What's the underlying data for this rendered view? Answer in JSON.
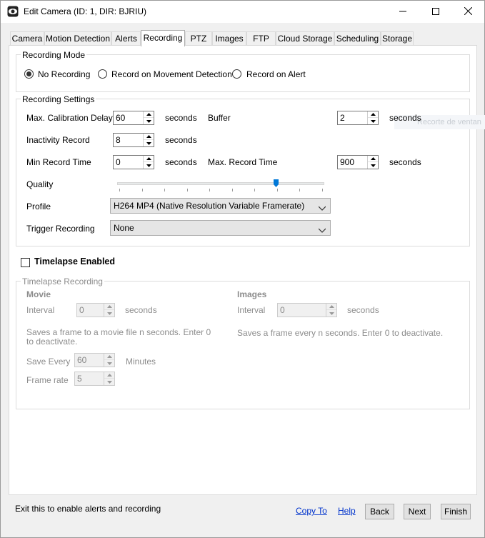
{
  "window": {
    "title": "Edit Camera (ID: 1, DIR: BJRIU)"
  },
  "tabs": [
    {
      "label": "Camera"
    },
    {
      "label": "Motion Detection"
    },
    {
      "label": "Alerts"
    },
    {
      "label": "Recording"
    },
    {
      "label": "PTZ"
    },
    {
      "label": "Images"
    },
    {
      "label": "FTP"
    },
    {
      "label": "Cloud Storage"
    },
    {
      "label": "Scheduling"
    },
    {
      "label": "Storage"
    }
  ],
  "active_tab": "Recording",
  "recording_mode": {
    "label": "Recording Mode",
    "options": [
      "No Recording",
      "Record on Movement Detection",
      "Record on Alert"
    ],
    "selected": "No Recording"
  },
  "recording_settings": {
    "label": "Recording Settings",
    "max_calibration_delay": {
      "label": "Max. Calibration Delay",
      "value": "60",
      "unit": "seconds"
    },
    "buffer": {
      "label": "Buffer",
      "value": "2",
      "unit": "seconds"
    },
    "inactivity_record": {
      "label": "Inactivity Record",
      "value": "8",
      "unit": "seconds"
    },
    "min_record_time": {
      "label": "Min Record Time",
      "value": "0",
      "unit": "seconds"
    },
    "max_record_time": {
      "label": "Max. Record Time",
      "value": "900",
      "unit": "seconds"
    },
    "quality": {
      "label": "Quality",
      "value_fraction": 0.77,
      "ticks": 10
    },
    "profile": {
      "label": "Profile",
      "value": "H264 MP4 (Native Resolution Variable Framerate)"
    },
    "trigger_recording": {
      "label": "Trigger Recording",
      "value": "None"
    },
    "ghost_text": "Recorte de ventan"
  },
  "timelapse": {
    "enabled_label": "Timelapse Enabled",
    "enabled": false,
    "group_label": "Timelapse Recording",
    "movie": {
      "heading": "Movie",
      "interval_label": "Interval",
      "interval_value": "0",
      "interval_unit": "seconds",
      "help": "Saves a frame to a movie file n seconds. Enter 0 to deactivate.",
      "save_every_label": "Save Every",
      "save_every_value": "60",
      "save_every_unit": "Minutes",
      "frame_rate_label": "Frame rate",
      "frame_rate_value": "5"
    },
    "images": {
      "heading": "Images",
      "interval_label": "Interval",
      "interval_value": "0",
      "interval_unit": "seconds",
      "help": "Saves a frame every n seconds. Enter 0 to deactivate."
    }
  },
  "footer": {
    "status": "Exit this to enable alerts and recording",
    "copy_to": "Copy To",
    "help": "Help",
    "back": "Back",
    "next": "Next",
    "finish": "Finish"
  }
}
